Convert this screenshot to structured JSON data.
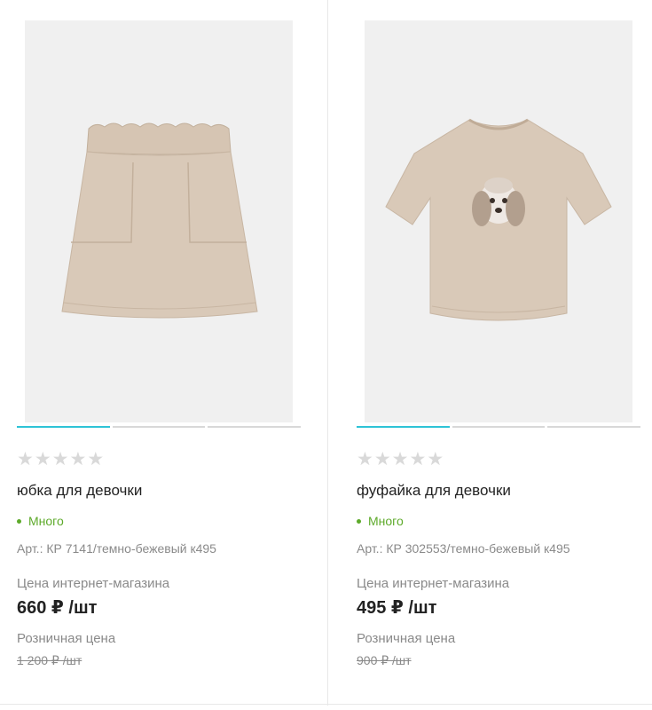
{
  "products": [
    {
      "image": "skirt-image",
      "gallery_count": 3,
      "gallery_active": 0,
      "rating": 0,
      "stars": [
        "★",
        "★",
        "★",
        "★",
        "★"
      ],
      "title": "юбка для девочки",
      "stock": "Много",
      "article": "Арт.: КР 7141/темно-бежевый к495",
      "price_label": "Цена интернет-магазина",
      "price": "660 ₽ /шт",
      "retail_label": "Розничная цена",
      "retail_price": "1 200 ₽ /шт"
    },
    {
      "image": "tshirt-image",
      "gallery_count": 3,
      "gallery_active": 0,
      "rating": 0,
      "stars": [
        "★",
        "★",
        "★",
        "★",
        "★"
      ],
      "title": "фуфайка для девочки",
      "stock": "Много",
      "article": "Арт.: КР 302553/темно-бежевый к495",
      "price_label": "Цена интернет-магазина",
      "price": "495 ₽ /шт",
      "retail_label": "Розничная цена",
      "retail_price": "900 ₽ /шт"
    }
  ],
  "colors": {
    "accent": "#2ec3d6",
    "stock_green": "#5daa2a",
    "star_empty": "#d9d9d9",
    "photo_bg": "#f0f0f0",
    "garment": "#d9c9b8"
  }
}
